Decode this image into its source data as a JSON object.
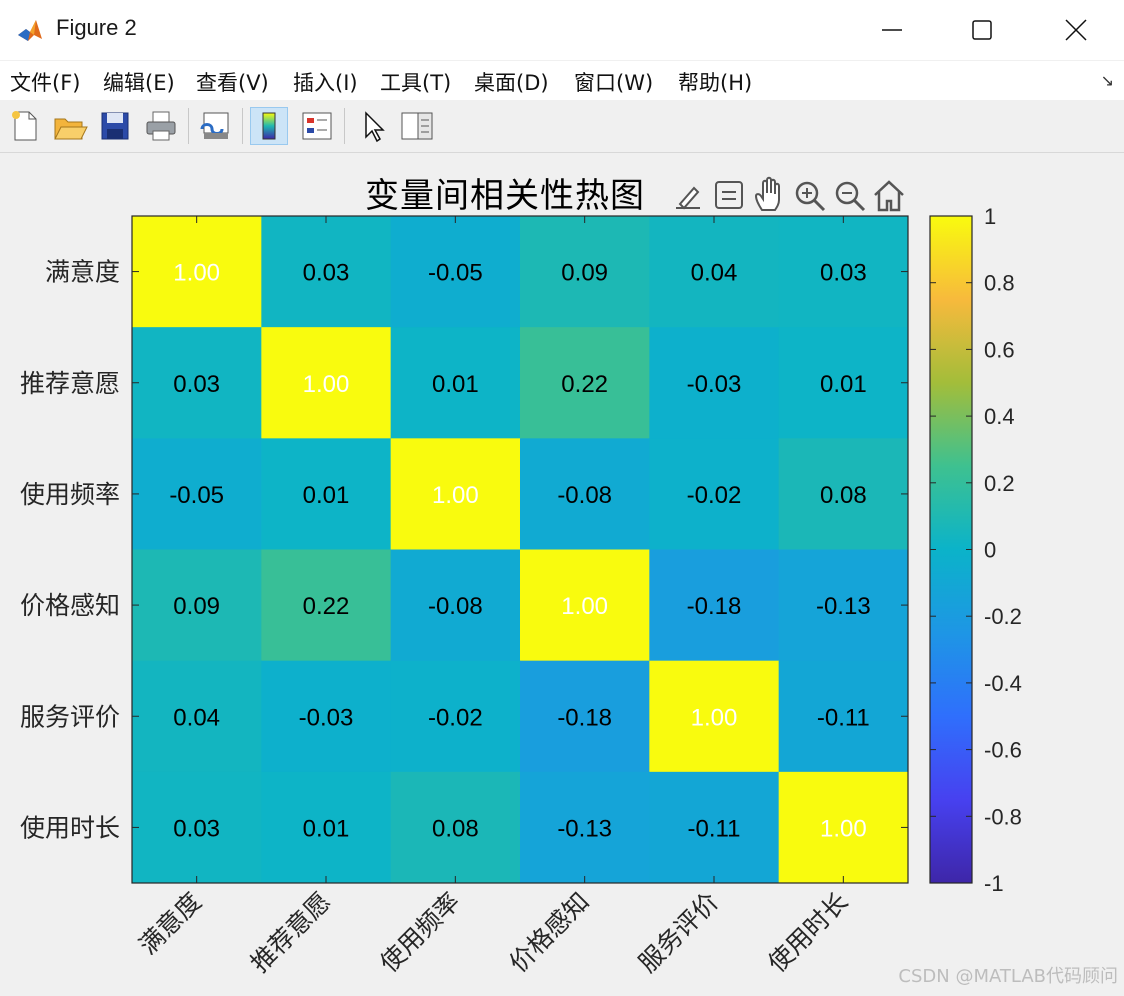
{
  "window": {
    "title": "Figure 2",
    "minimize_icon": "minimize-icon",
    "maximize_icon": "maximize-icon",
    "close_icon": "close-icon"
  },
  "menu": {
    "items": [
      "文件(F)",
      "编辑(E)",
      "查看(V)",
      "插入(I)",
      "工具(T)",
      "桌面(D)",
      "窗口(W)",
      "帮助(H)"
    ],
    "overflow_icon": "expand-arrow-icon"
  },
  "toolbar": {
    "buttons": [
      "new-figure-icon",
      "open-file-icon",
      "save-icon",
      "print-icon",
      "link-plot-icon",
      "colorbar-icon",
      "legend-icon",
      "pointer-icon",
      "property-inspector-icon"
    ]
  },
  "axes_toolbar": {
    "buttons": [
      "brush-icon",
      "data-tips-icon",
      "pan-hand-icon",
      "zoom-in-icon",
      "zoom-out-icon",
      "home-icon"
    ]
  },
  "chart_data": {
    "type": "heatmap",
    "title": "变量间相关性热图",
    "row_labels": [
      "满意度",
      "推荐意愿",
      "使用频率",
      "价格感知",
      "服务评价",
      "使用时长"
    ],
    "col_labels": [
      "满意度",
      "推荐意愿",
      "使用频率",
      "价格感知",
      "服务评价",
      "使用时长"
    ],
    "values": [
      [
        1.0,
        0.03,
        -0.05,
        0.09,
        0.04,
        0.03
      ],
      [
        0.03,
        1.0,
        0.01,
        0.22,
        -0.03,
        0.01
      ],
      [
        -0.05,
        0.01,
        1.0,
        -0.08,
        -0.02,
        0.08
      ],
      [
        0.09,
        0.22,
        -0.08,
        1.0,
        -0.18,
        -0.13
      ],
      [
        0.04,
        -0.03,
        -0.02,
        -0.18,
        1.0,
        -0.11
      ],
      [
        0.03,
        0.01,
        0.08,
        -0.13,
        -0.11,
        1.0
      ]
    ],
    "cell_labels": [
      [
        "1.00",
        "0.03",
        "-0.05",
        "0.09",
        "0.04",
        "0.03"
      ],
      [
        "0.03",
        "1.00",
        "0.01",
        "0.22",
        "-0.03",
        "0.01"
      ],
      [
        "-0.05",
        "0.01",
        "1.00",
        "-0.08",
        "-0.02",
        "0.08"
      ],
      [
        "0.09",
        "0.22",
        "-0.08",
        "1.00",
        "-0.18",
        "-0.13"
      ],
      [
        "0.04",
        "-0.03",
        "-0.02",
        "-0.18",
        "1.00",
        "-0.11"
      ],
      [
        "0.03",
        "0.01",
        "0.08",
        "-0.13",
        "-0.11",
        "1.00"
      ]
    ],
    "colormap": "parula",
    "clim": [
      -1,
      1
    ],
    "colorbar_ticks": [
      1,
      0.8,
      0.6,
      0.4,
      0.2,
      0,
      -0.2,
      -0.4,
      -0.6,
      -0.8,
      -1
    ],
    "colorbar_tick_labels": [
      "1",
      "0.8",
      "0.6",
      "0.4",
      "0.2",
      "0",
      "-0.2",
      "-0.4",
      "-0.6",
      "-0.8",
      "-1"
    ],
    "xtick_rotation": 45,
    "diagonal_text_color": "#ffffff",
    "offdiagonal_text_color": "#000000"
  },
  "watermark": "CSDN @MATLAB代码顾问"
}
